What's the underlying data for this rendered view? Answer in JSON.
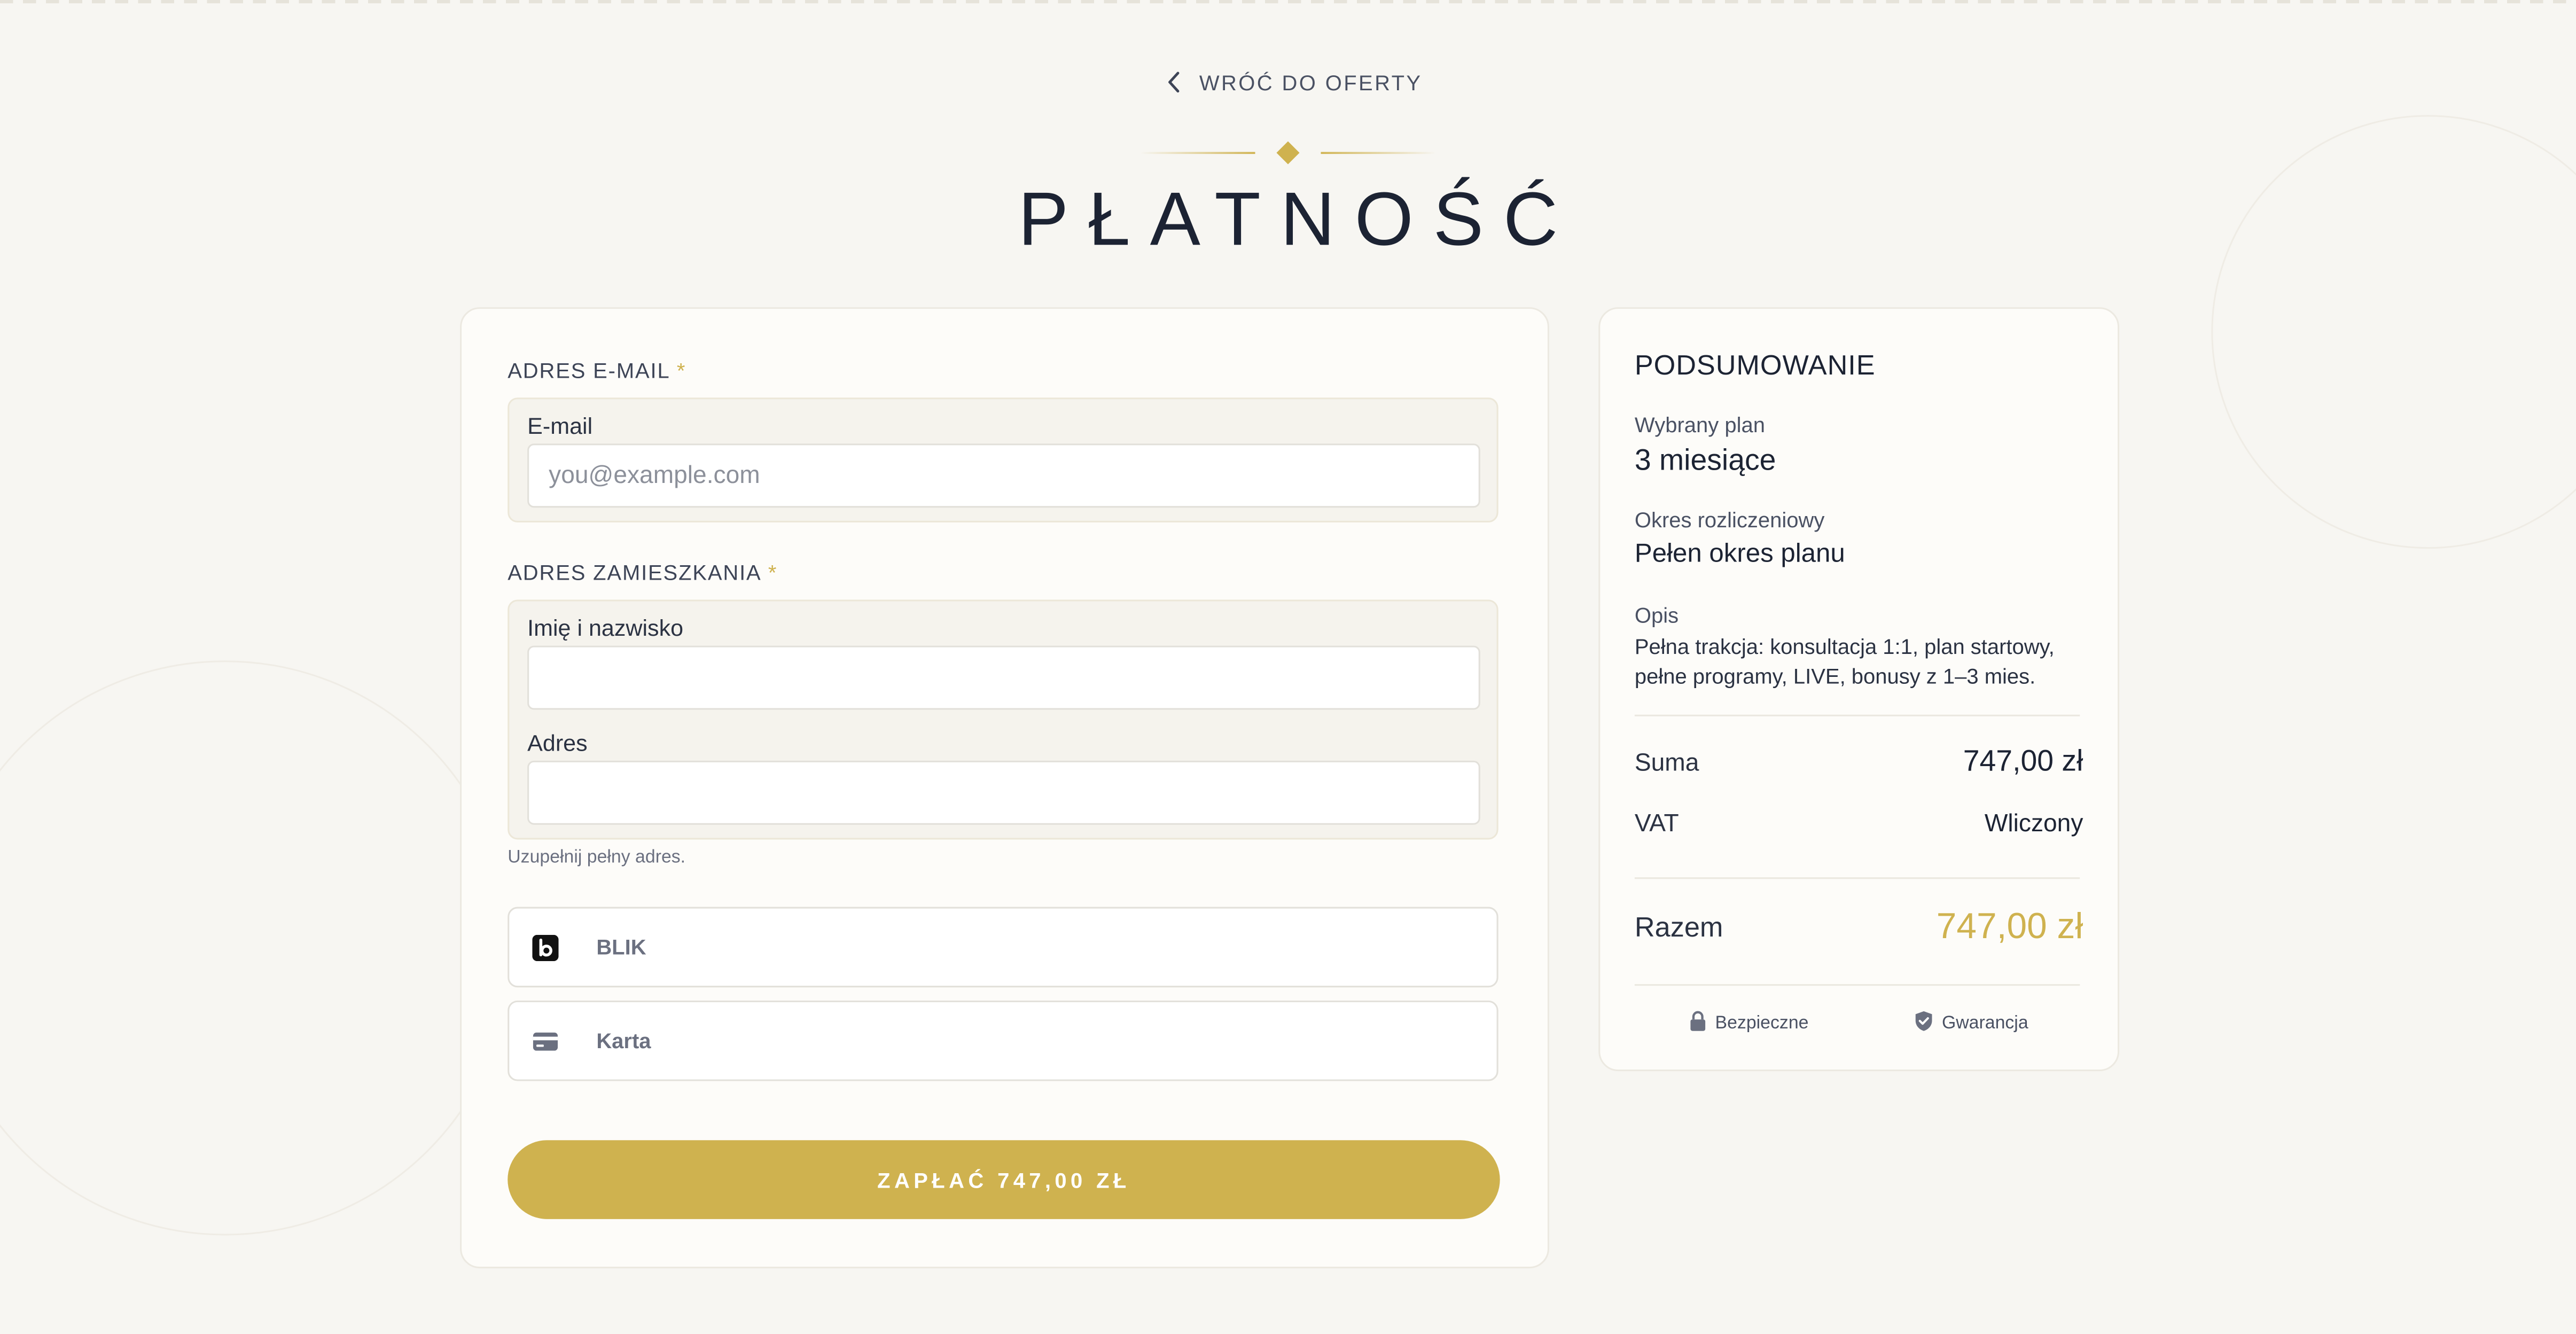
{
  "nav": {
    "back_label": "WRÓĆ DO OFERTY"
  },
  "page": {
    "title": "PŁATNOŚĆ"
  },
  "colors": {
    "accent": "#cfb24f",
    "text": "#1c2333",
    "background": "#f7f6f2"
  },
  "form": {
    "email_section": {
      "label": "ADRES E-MAIL",
      "required_mark": "*"
    },
    "email_field": {
      "label": "E-mail",
      "value": "",
      "placeholder": "you@example.com"
    },
    "address_section": {
      "label": "ADRES ZAMIESZKANIA",
      "required_mark": "*"
    },
    "name_field": {
      "label": "Imię i nazwisko",
      "value": ""
    },
    "address_field": {
      "label": "Adres",
      "value": ""
    },
    "address_hint": "Uzupełnij pełny adres.",
    "payment_methods": [
      {
        "label": "BLIK",
        "icon": "blik-icon"
      },
      {
        "label": "Karta",
        "icon": "credit-card-icon"
      }
    ],
    "pay_button_label": "ZAPŁAĆ 747,00 ZŁ"
  },
  "summary": {
    "heading": "PODSUMOWANIE",
    "plan_label": "Wybrany plan",
    "plan_value": "3 miesiące",
    "period_label": "Okres rozliczeniowy",
    "period_value": "Pełen okres planu",
    "description_label": "Opis",
    "description": "Pełna trakcja: konsultacja 1:1, plan startowy, pełne programy, LIVE, bonusy z 1–3 mies.",
    "sum_label": "Suma",
    "sum_value": "747,00 zł",
    "vat_label": "VAT",
    "vat_value": "Wliczony",
    "total_label": "Razem",
    "total_value": "747,00 zł",
    "badges": [
      {
        "label": "Bezpieczne",
        "icon": "lock-icon"
      },
      {
        "label": "Gwarancja",
        "icon": "shield-check-icon"
      }
    ]
  }
}
